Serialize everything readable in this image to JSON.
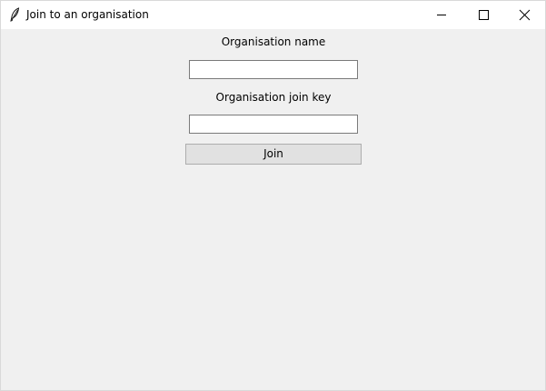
{
  "window": {
    "title": "Join to an organisation",
    "icon": "feather-icon",
    "controls": [
      "minimize-icon",
      "maximize-icon",
      "close-icon"
    ]
  },
  "form": {
    "org_name_label": "Organisation name",
    "org_name_value": "",
    "org_key_label": "Organisation join key",
    "org_key_value": "",
    "join_label": "Join"
  },
  "colors": {
    "window_bg": "#f0f0f0",
    "titlebar_bg": "#ffffff",
    "button_bg": "#e1e1e1",
    "input_border": "#7a7a7a"
  }
}
